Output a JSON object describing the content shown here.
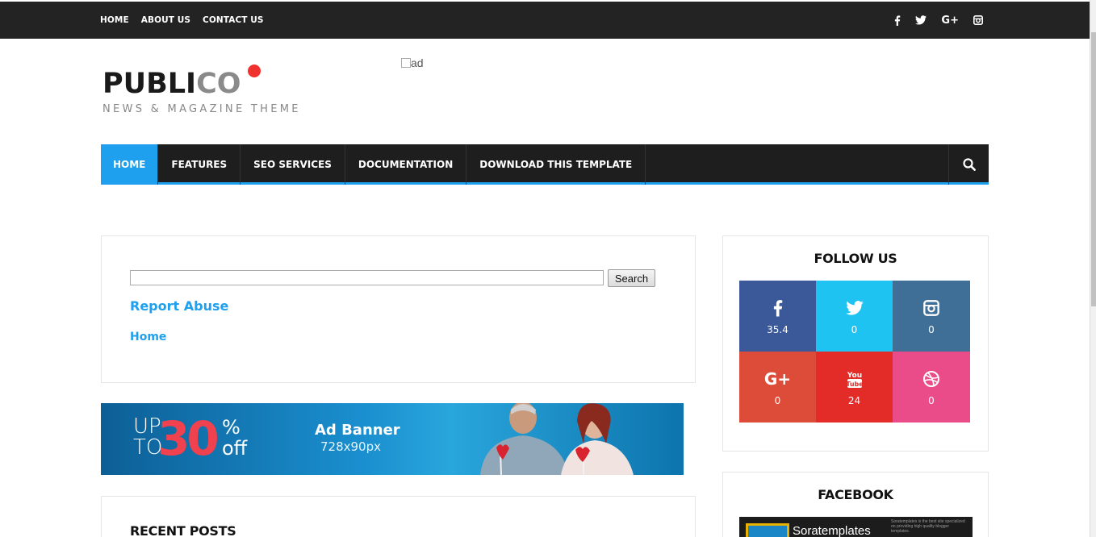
{
  "topbar": {
    "links": [
      "HOME",
      "ABOUT US",
      "CONTACT US"
    ],
    "social_icons": [
      "facebook-icon",
      "twitter-icon",
      "google-plus-icon",
      "instagram-icon"
    ]
  },
  "logo": {
    "part1": "PUBLI",
    "part2": "CO",
    "tagline": "NEWS & MAGAZINE THEME"
  },
  "header_ad_alt": "ad",
  "nav": {
    "items": [
      "HOME",
      "FEATURES",
      "SEO SERVICES",
      "DOCUMENTATION",
      "DOWNLOAD THIS TEMPLATE"
    ],
    "active_index": 0
  },
  "search_widget": {
    "input_value": "",
    "button_label": "Search",
    "report_abuse": "Report Abuse",
    "home_link": "Home"
  },
  "banner": {
    "up_to_line1": "UP",
    "up_to_line2": "TO",
    "percent_value": "30",
    "percent_sign": "%",
    "off": "off",
    "title": "Ad Banner",
    "size": "728x90px"
  },
  "recent_posts": {
    "title": "RECENT POSTS"
  },
  "follow_us": {
    "title": "FOLLOW US",
    "items": [
      {
        "icon": "facebook-icon",
        "count": "35.4",
        "color": "#3b5998"
      },
      {
        "icon": "twitter-icon",
        "count": "0",
        "color": "#1ec3f2"
      },
      {
        "icon": "instagram-icon",
        "count": "0",
        "color": "#3f6f97"
      },
      {
        "icon": "google-plus-icon",
        "count": "0",
        "color": "#dd4b39"
      },
      {
        "icon": "youtube-icon",
        "count": "24",
        "color": "#e32b28"
      },
      {
        "icon": "dribbble-icon",
        "count": "0",
        "color": "#ea4c89"
      }
    ]
  },
  "facebook": {
    "title": "FACEBOOK",
    "page_name": "Soratemplates",
    "page_desc": "Soratemplates is the best site specialized on providing high quality blogger templates."
  },
  "colors": {
    "accent": "#1ea0ee",
    "dark": "#1e1e1e",
    "logo_dot": "#f0322f"
  }
}
